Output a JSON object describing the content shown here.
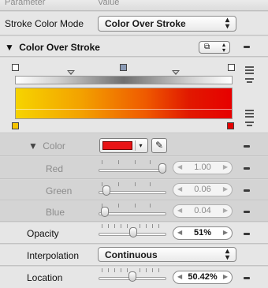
{
  "header": {
    "col_parameter": "Parameter",
    "col_value": "Value"
  },
  "stroke_color_mode": {
    "label": "Stroke Color Mode",
    "value": "Color Over Stroke"
  },
  "group": {
    "label": "Color Over Stroke",
    "disclosure": "▼"
  },
  "gradient": {
    "top_stops": [
      "#ffffff",
      "#8a9ab5",
      "#ffffff"
    ],
    "bottom_stops": [
      "#f5c400",
      "#e50000"
    ]
  },
  "color": {
    "label": "Color",
    "disclosure": "▼",
    "swatch": "#e81416"
  },
  "red": {
    "label": "Red",
    "value": "1.00",
    "level": 1.0
  },
  "green": {
    "label": "Green",
    "value": "0.06",
    "level": 0.06
  },
  "blue": {
    "label": "Blue",
    "value": "0.04",
    "level": 0.04
  },
  "opacity": {
    "label": "Opacity",
    "value": "51%",
    "level": 0.51
  },
  "interpolation": {
    "label": "Interpolation",
    "value": "Continuous"
  },
  "location": {
    "label": "Location",
    "value": "50.42%",
    "level": 0.5042
  },
  "icons": {
    "left_arrow": "◀",
    "right_arrow": "▶",
    "updown": "⇕",
    "dropper": "✎",
    "dropdown": "▾"
  }
}
